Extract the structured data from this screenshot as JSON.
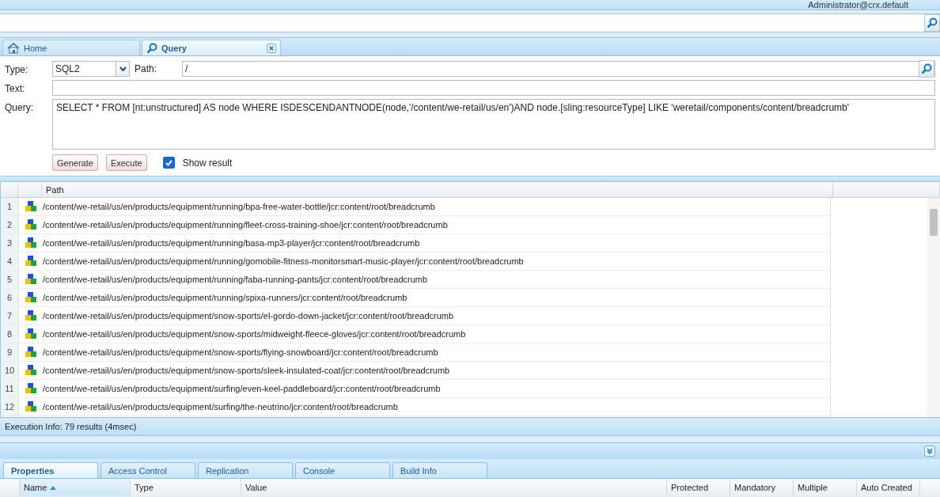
{
  "user": "Administrator@crx.default",
  "tabs": [
    {
      "label": "Home",
      "kind": "home",
      "selected": false,
      "closable": false
    },
    {
      "label": "Query",
      "kind": "search",
      "selected": true,
      "closable": true
    }
  ],
  "form": {
    "type_label": "Type:",
    "type_value": "SQL2",
    "path_label": "Path:",
    "path_value": "/",
    "text_label": "Text:",
    "query_label": "Query:",
    "query_value": "SELECT * FROM [nt:unstructured] AS node WHERE ISDESCENDANTNODE(node,'/content/we-retail/us/en')AND node.[sling:resourceType] LIKE 'weretail/components/content/breadcrumb'",
    "buttons": [
      "Generate",
      "Execute"
    ],
    "show_result": {
      "label": "Show result",
      "checked": true
    }
  },
  "results": {
    "columns": [
      "Path"
    ],
    "rows": [
      {
        "n": "1",
        "path": "/content/we-retail/us/en/products/equipment/running/bpa-free-water-bottle/jcr:content/root/breadcrumb"
      },
      {
        "n": "2",
        "path": "/content/we-retail/us/en/products/equipment/running/fleet-cross-training-shoe/jcr:content/root/breadcrumb"
      },
      {
        "n": "3",
        "path": "/content/we-retail/us/en/products/equipment/running/basa-mp3-player/jcr:content/root/breadcrumb"
      },
      {
        "n": "4",
        "path": "/content/we-retail/us/en/products/equipment/running/gomobile-fitness-monitorsmart-music-player/jcr:content/root/breadcrumb"
      },
      {
        "n": "5",
        "path": "/content/we-retail/us/en/products/equipment/running/faba-running-pants/jcr:content/root/breadcrumb"
      },
      {
        "n": "6",
        "path": "/content/we-retail/us/en/products/equipment/running/spixa-runners/jcr:content/root/breadcrumb"
      },
      {
        "n": "7",
        "path": "/content/we-retail/us/en/products/equipment/snow-sports/el-gordo-down-jacket/jcr:content/root/breadcrumb"
      },
      {
        "n": "8",
        "path": "/content/we-retail/us/en/products/equipment/snow-sports/midweight-fleece-gloves/jcr:content/root/breadcrumb"
      },
      {
        "n": "9",
        "path": "/content/we-retail/us/en/products/equipment/snow-sports/flying-snowboard/jcr:content/root/breadcrumb"
      },
      {
        "n": "10",
        "path": "/content/we-retail/us/en/products/equipment/snow-sports/sleek-insulated-coat/jcr:content/root/breadcrumb"
      },
      {
        "n": "11",
        "path": "/content/we-retail/us/en/products/equipment/surfing/even-keel-paddleboard/jcr:content/root/breadcrumb"
      },
      {
        "n": "12",
        "path": "/content/we-retail/us/en/products/equipment/surfing/the-neutrino/jcr:content/root/breadcrumb"
      }
    ],
    "info": "Execution Info: 79 results (4msec)"
  },
  "bottom_tabs": [
    {
      "label": "Properties",
      "selected": true
    },
    {
      "label": "Access Control",
      "selected": false
    },
    {
      "label": "Replication",
      "selected": false
    },
    {
      "label": "Console",
      "selected": false
    },
    {
      "label": "Build Info",
      "selected": false
    }
  ],
  "properties_columns": [
    {
      "label": "Name",
      "sorted": true
    },
    {
      "label": "Type",
      "sorted": false
    },
    {
      "label": "Value",
      "sorted": false
    },
    {
      "label": "Protected",
      "sorted": false
    },
    {
      "label": "Mandatory",
      "sorted": false
    },
    {
      "label": "Multiple",
      "sorted": false
    },
    {
      "label": "Auto Created",
      "sorted": false
    }
  ]
}
